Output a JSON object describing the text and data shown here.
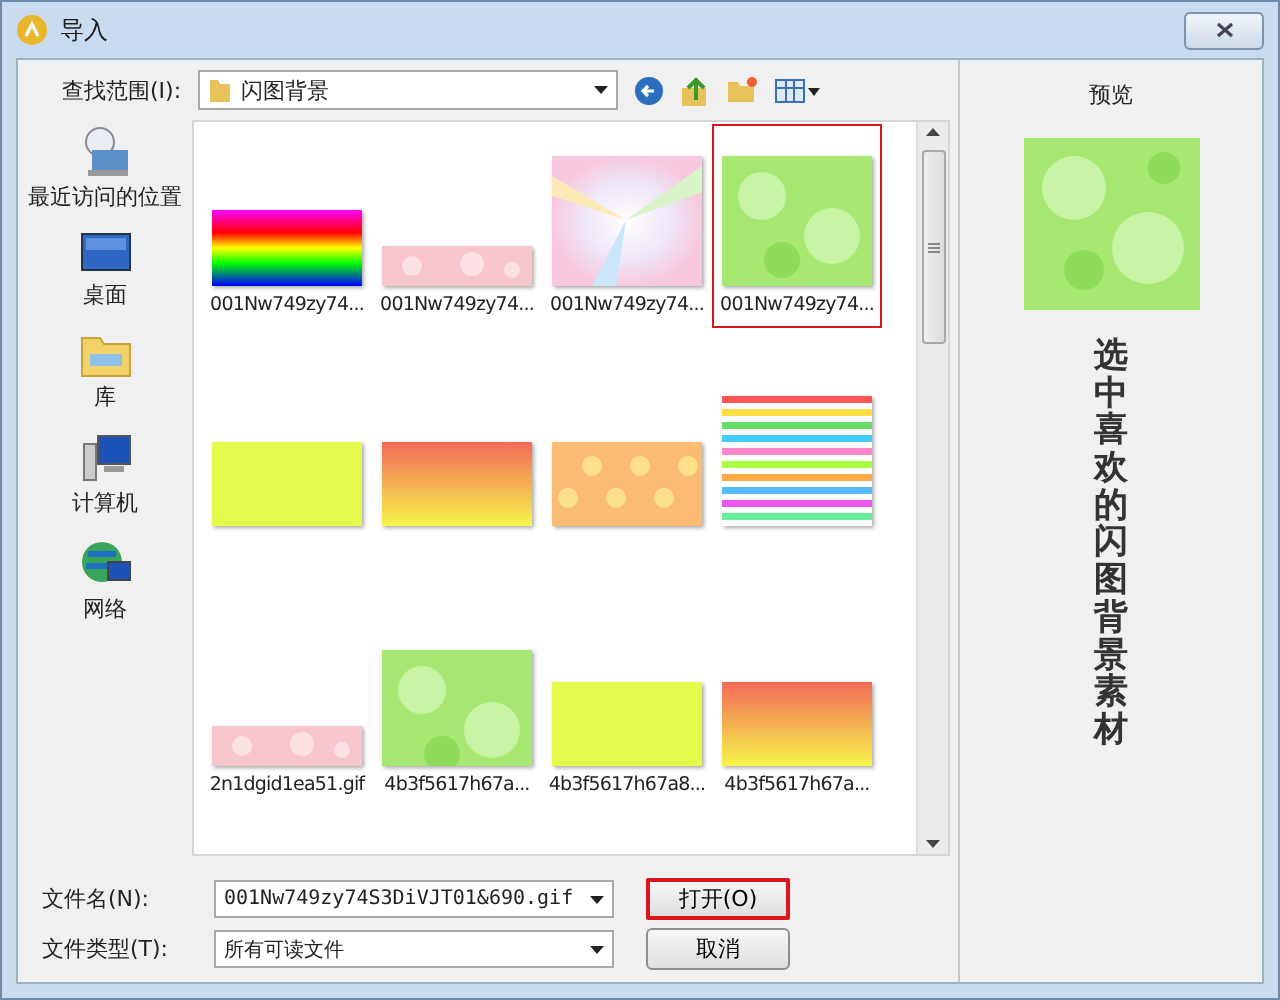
{
  "window": {
    "title": "导入"
  },
  "look_in": {
    "label": "查找范围(I):",
    "value": "闪图背景"
  },
  "places": [
    {
      "label": "最近访问的位置",
      "kind": "recent"
    },
    {
      "label": "桌面",
      "kind": "desktop"
    },
    {
      "label": "库",
      "kind": "library"
    },
    {
      "label": "计算机",
      "kind": "computer"
    },
    {
      "label": "网络",
      "kind": "network"
    }
  ],
  "files": [
    {
      "name": "001Nw749zy74...",
      "selected": false
    },
    {
      "name": "001Nw749zy74...",
      "selected": false
    },
    {
      "name": "001Nw749zy74...",
      "selected": false
    },
    {
      "name": "001Nw749zy74...",
      "selected": true
    },
    {
      "selected": false
    },
    {
      "selected": false
    },
    {
      "selected": false
    },
    {
      "selected": false
    },
    {
      "name": "2n1dgid1ea51.gif",
      "selected": false
    },
    {
      "name": "4b3f5617h67a...",
      "selected": false
    },
    {
      "name": "4b3f5617h67a8...",
      "selected": false
    },
    {
      "name": "4b3f5617h67a...",
      "selected": false
    }
  ],
  "file_name": {
    "label": "文件名(N):",
    "value": "001Nw749zy74S3DiVJT01&690.gif"
  },
  "file_type": {
    "label": "文件类型(T):",
    "value": "所有可读文件"
  },
  "buttons": [
    {
      "label": "打开(O)",
      "focused": true
    },
    {
      "label": "取消",
      "focused": false
    }
  ],
  "preview": {
    "title": "预览",
    "caption": "选中喜欢的闪图背景素材"
  }
}
